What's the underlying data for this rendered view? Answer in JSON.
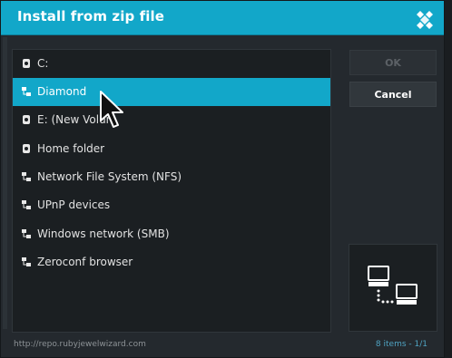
{
  "dialog": {
    "title": "Install from zip file",
    "logo_icon": "kodi-logo-icon"
  },
  "sources": [
    {
      "label": "C:",
      "icon": "hard-drive-icon",
      "focused": false
    },
    {
      "label": "Diamond",
      "icon": "network-share-icon",
      "focused": true
    },
    {
      "label": "E: (New Volum",
      "icon": "hard-drive-icon",
      "focused": false
    },
    {
      "label": "Home folder",
      "icon": "hard-drive-icon",
      "focused": false
    },
    {
      "label": "Network File System (NFS)",
      "icon": "network-share-icon",
      "focused": false
    },
    {
      "label": "UPnP devices",
      "icon": "network-share-icon",
      "focused": false
    },
    {
      "label": "Windows network (SMB)",
      "icon": "network-share-icon",
      "focused": false
    },
    {
      "label": "Zeroconf browser",
      "icon": "network-share-icon",
      "focused": false
    }
  ],
  "buttons": {
    "ok_label": "OK",
    "cancel_label": "Cancel"
  },
  "preview": {
    "icon": "network-computers-icon"
  },
  "footer": {
    "path": "http://repo.rubyjewelwizard.com",
    "count": "8 items - ",
    "page": "1/1"
  },
  "colors": {
    "accent": "#12a7c9",
    "background": "#24292e"
  }
}
